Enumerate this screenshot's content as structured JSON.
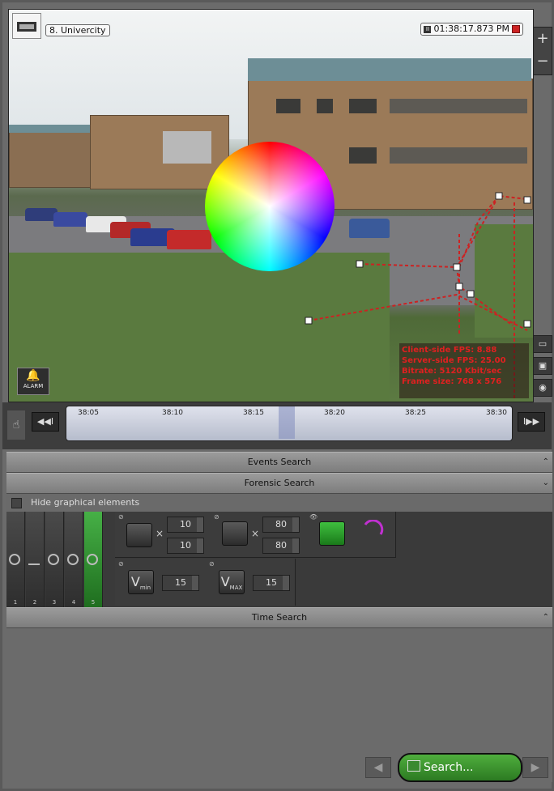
{
  "video": {
    "camera_label": "8. Univercity",
    "timestamp": "01:38:17.873 PM",
    "stats": [
      "Client-side FPS: 8.88",
      "Server-side FPS: 25.00",
      "Bitrate: 5120 Kbit/sec",
      "Frame size: 768 x 576"
    ],
    "alarm_label": "ALARM"
  },
  "zoom": {
    "plus": "+",
    "minus": "−"
  },
  "timeline": {
    "ticks": [
      "38:05",
      "38:10",
      "38:15",
      "38:20",
      "38:25",
      "38:30"
    ]
  },
  "panels": {
    "events_search": "Events Search",
    "forensic_search": "Forensic Search",
    "hide_graphical": "Hide graphical elements",
    "time_search": "Time Search"
  },
  "forensic": {
    "tabs": [
      "1",
      "2",
      "3",
      "4",
      "5"
    ],
    "active_tab": "5",
    "min_size": [
      "10",
      "10"
    ],
    "max_size": [
      "80",
      "80"
    ],
    "vmin": "15",
    "vmax": "15",
    "vmin_label": "V",
    "vmin_sub": "min",
    "vmax_label": "V",
    "vmax_sub": "MAX",
    "times": "×"
  },
  "actions": {
    "search_label": "Search..."
  }
}
